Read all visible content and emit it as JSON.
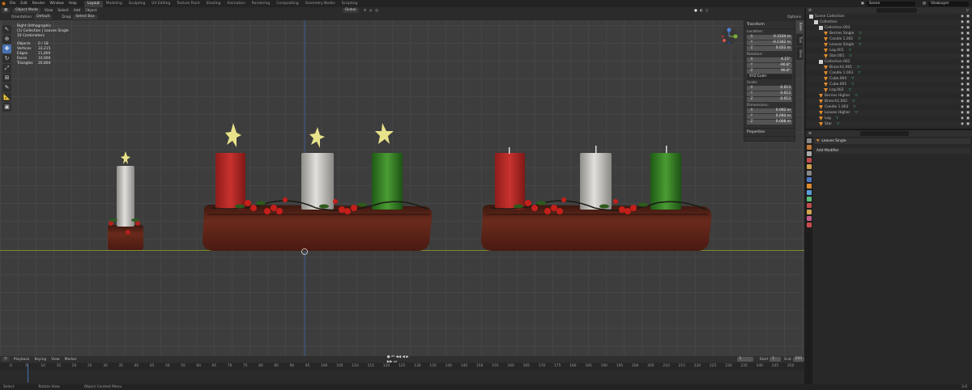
{
  "topbar": {
    "menus": [
      "File",
      "Edit",
      "Render",
      "Window",
      "Help"
    ],
    "tabs": [
      "Layout",
      "Modeling",
      "Sculpting",
      "UV Editing",
      "Texture Paint",
      "Shading",
      "Animation",
      "Rendering",
      "Compositing",
      "Geometry Nodes",
      "Scripting"
    ],
    "active_tab": "Layout",
    "scene": "Scene",
    "view_layer": "ViewLayer"
  },
  "header": {
    "mode": "Object Mode",
    "menus": [
      "View",
      "Select",
      "Add",
      "Object"
    ],
    "orientation": "Global"
  },
  "header2": {
    "orientation_label": "Orientation:",
    "orientation_value": "Default",
    "drag_label": "Drag:",
    "drag_value": "Select Box",
    "options": "Options"
  },
  "stats": {
    "view_name": "Right Orthographic",
    "collection": "(1) Collection | Leaves Single",
    "units": "10 Centimeters",
    "rows": [
      {
        "k": "Objects",
        "v": "0 / 18"
      },
      {
        "k": "Vertices",
        "v": "33,215"
      },
      {
        "k": "Edges",
        "v": "21,800"
      },
      {
        "k": "Faces",
        "v": "10,900"
      },
      {
        "k": "Triangles",
        "v": "20,804"
      }
    ]
  },
  "npanel": {
    "title": "Transform",
    "location": "Location:",
    "loc": [
      {
        "a": "X",
        "v": "0.3104 m"
      },
      {
        "a": "Y",
        "v": "-0.1342 m"
      },
      {
        "a": "Z",
        "v": "0.022 m"
      }
    ],
    "rotation": "Rotation:",
    "rot": [
      {
        "a": "X",
        "v": "4.15°"
      },
      {
        "a": "Y",
        "v": "-90.8°"
      },
      {
        "a": "Z",
        "v": "90.8°"
      }
    ],
    "mode": "XYZ Euler",
    "scale": "Scale:",
    "scl": [
      {
        "a": "X",
        "v": "0.013"
      },
      {
        "a": "Y",
        "v": "0.013"
      },
      {
        "a": "Z",
        "v": "0.013"
      }
    ],
    "dimensions": "Dimensions:",
    "dim": [
      {
        "a": "X",
        "v": "0.092 m"
      },
      {
        "a": "Y",
        "v": "0.094 m"
      },
      {
        "a": "Z",
        "v": "0.008 m"
      }
    ],
    "properties": "Properties"
  },
  "ntabs": [
    "Item",
    "Tool",
    "View"
  ],
  "outliner": {
    "search": "",
    "rows": [
      {
        "t": "Scene Collection",
        "d": 0,
        "c": "#dcdcdc"
      },
      {
        "t": "Collection",
        "d": 1,
        "c": "#dcdcdc"
      },
      {
        "t": "Collection.003",
        "d": 2,
        "c": "#dcdcdc"
      },
      {
        "t": "Berries Single",
        "d": 3,
        "c": "#e08b2e"
      },
      {
        "t": "Candle 1.002",
        "d": 3,
        "c": "#e08b2e"
      },
      {
        "t": "Leaves Single",
        "d": 3,
        "c": "#e08b2e"
      },
      {
        "t": "Log.001",
        "d": 3,
        "c": "#e08b2e"
      },
      {
        "t": "Star.001",
        "d": 3,
        "c": "#e08b2e"
      },
      {
        "t": "Collection.002",
        "d": 2,
        "c": "#dcdcdc"
      },
      {
        "t": "Branch1.001",
        "d": 3,
        "c": "#e08b2e"
      },
      {
        "t": "Candle 1.003",
        "d": 3,
        "c": "#e08b2e"
      },
      {
        "t": "Cube.004",
        "d": 3,
        "c": "#e08b2e"
      },
      {
        "t": "Cube.005",
        "d": 3,
        "c": "#e08b2e"
      },
      {
        "t": "Log.002",
        "d": 3,
        "c": "#e08b2e"
      },
      {
        "t": "Berries Higher",
        "d": 2,
        "c": "#e08b2e"
      },
      {
        "t": "Branch1.002",
        "d": 2,
        "c": "#e08b2e"
      },
      {
        "t": "Candle 1.003",
        "d": 2,
        "c": "#e08b2e"
      },
      {
        "t": "Leaves Higher",
        "d": 2,
        "c": "#e08b2e"
      },
      {
        "t": "Log",
        "d": 2,
        "c": "#e08b2e"
      },
      {
        "t": "Star",
        "d": 2,
        "c": "#e08b2e"
      }
    ]
  },
  "props": {
    "object": "Leaves Single",
    "add_modifier": "Add Modifier"
  },
  "timeline": {
    "menus": [
      "Playback",
      "Keying",
      "View",
      "Marker"
    ],
    "frame": "1",
    "start_label": "Start",
    "start": "1",
    "end_label": "End",
    "end": "250",
    "ticks": [
      "0",
      "5",
      "10",
      "15",
      "20",
      "25",
      "30",
      "35",
      "40",
      "45",
      "50",
      "55",
      "60",
      "65",
      "70",
      "75",
      "80",
      "85",
      "90",
      "95",
      "100",
      "105",
      "110",
      "115",
      "120",
      "125",
      "130",
      "135",
      "140",
      "145",
      "150",
      "155",
      "160",
      "165",
      "170",
      "175",
      "180",
      "185",
      "190",
      "195",
      "200",
      "205",
      "210",
      "215",
      "220",
      "225",
      "230",
      "235",
      "240",
      "245",
      "250"
    ]
  },
  "status": {
    "select": "Select",
    "rotate": "Rotate View",
    "context": "Object Context Menu",
    "version": "3.6"
  },
  "colors": {
    "accent": "#4772b3",
    "red_candle": "#c2302d",
    "white_candle": "#d8d6d2",
    "green_candle": "#3e8a2c",
    "log": "#5a2218",
    "star": "#e8e28a"
  }
}
